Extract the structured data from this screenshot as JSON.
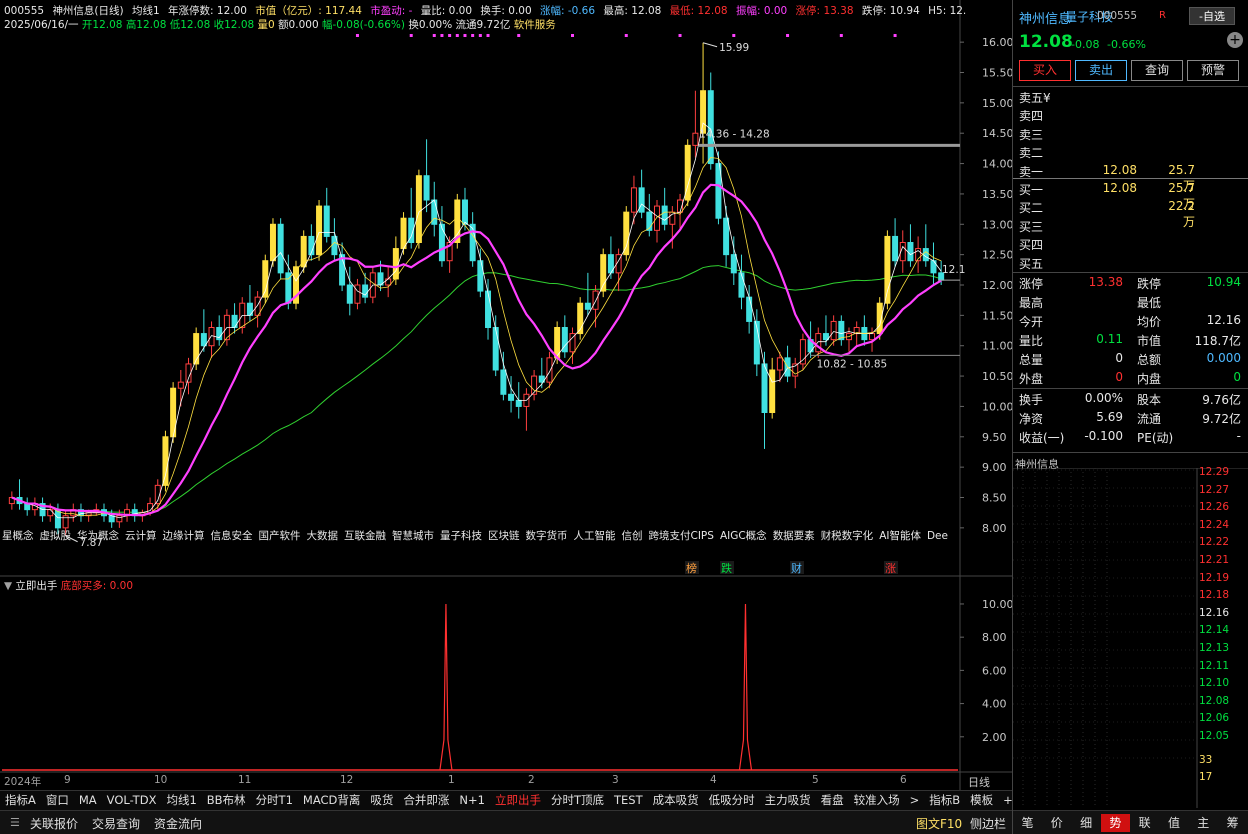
{
  "header": {
    "code": "000555",
    "name": "神州信息(日线)",
    "ma_label": "均线1",
    "ma_desc": "年涨停数: 12.00",
    "mktcap_label": "市值（亿元）: 117.44",
    "pe_label": "市盈动: -",
    "volratio": "量比: 0.00",
    "turnover": "换手: 0.00",
    "amp_label": "涨幅: -0.66",
    "high": "最高: 12.08",
    "low": "最低: 12.08",
    "swing": "振幅: 0.00",
    "limitup": "涨停: 13.38",
    "limitdown": "跌停: 10.94",
    "h5": "H5: 12.",
    "line2_date": "2025/06/16/一",
    "line2_open": "开12.08",
    "line2_high": "高12.08",
    "line2_low": "低12.08",
    "line2_close": "收12.08",
    "line2_vol": "量0",
    "line2_amt": "额0.000",
    "line2_chg": "幅-0.08(-0.66%)",
    "line2_turn": "换0.00%",
    "line2_float": "流通9.72亿",
    "line2_sector": "软件服务"
  },
  "concepts": [
    "星概念",
    "虚拟股",
    "华为概念",
    "云计算",
    "边缘计算",
    "信息安全",
    "国产软件",
    "大数据",
    "互联金融",
    "智慧城市",
    "量子科技",
    "区块链",
    "数字货币",
    "人工智能",
    "信创",
    "跨境支付CIPS",
    "AIGC概念",
    "数据要素",
    "财税数字化",
    "AI智能体",
    "Dee"
  ],
  "annotations": {
    "high_label": "15.99",
    "low_label": "7.87",
    "range1": "14.36 - 14.28",
    "range2": "10.82 - 10.85",
    "last_tag": "12.1"
  },
  "event_tags": [
    {
      "text": "榜",
      "color": "#ffa040"
    },
    {
      "text": "跌",
      "color": "#00e040"
    },
    {
      "text": "财",
      "color": "#4fb9ff"
    },
    {
      "text": "涨",
      "color": "#ff3030"
    }
  ],
  "yaxis": [
    "16.00",
    "15.50",
    "15.00",
    "14.50",
    "14.00",
    "13.50",
    "13.00",
    "12.50",
    "12.00",
    "11.50",
    "11.00",
    "10.50",
    "10.00",
    "9.50",
    "9.00",
    "8.50",
    "8.00"
  ],
  "indicator": {
    "name": "立即出手",
    "value_label": "底部买多: 0.00",
    "yaxis": [
      "10.00",
      "8.00",
      "6.00",
      "4.00",
      "2.00"
    ]
  },
  "xaxis": [
    "2024年",
    "9",
    "10",
    "11",
    "12",
    "1",
    "2",
    "3",
    "4",
    "5",
    "6"
  ],
  "period_button": "日线",
  "tabs": [
    "指标A",
    "窗口",
    "MA",
    "VOL-TDX",
    "均线1",
    "BB布林",
    "分时T1",
    "MACD背离",
    "吸货",
    "合并即涨",
    "N+1",
    "立即出手",
    "分时T顶底",
    "TEST",
    "成本吸货",
    "低吸分时",
    "主力吸货",
    "看盘",
    "较准入场",
    ">",
    "指标B",
    "模板",
    "+",
    "-"
  ],
  "active_tab": "立即出手",
  "status": {
    "link_quote": "关联报价",
    "trade_query": "交易查询",
    "capital_flow": "资金流向",
    "f10": "图文F10",
    "sidebar": "侧边栏"
  },
  "right": {
    "name": "神州信息",
    "concept": "量子科技",
    "code": "000555",
    "r_badge": "R",
    "zixuan": "-自选",
    "price": "12.08",
    "chg": "-0.08",
    "pct": "-0.66%",
    "buttons": {
      "buy": "买入",
      "sell": "卖出",
      "query": "查询",
      "alert": "预警"
    },
    "asks": [
      {
        "label": "卖五¥",
        "price": "",
        "vol": ""
      },
      {
        "label": "卖四",
        "price": "",
        "vol": ""
      },
      {
        "label": "卖三",
        "price": "",
        "vol": ""
      },
      {
        "label": "卖二",
        "price": "",
        "vol": ""
      },
      {
        "label": "卖一",
        "price": "12.08",
        "vol": "25.7万"
      }
    ],
    "bids": [
      {
        "label": "买一",
        "price": "12.08",
        "vol": "25.7万"
      },
      {
        "label": "买二",
        "price": "",
        "vol": "22.2万"
      },
      {
        "label": "买三",
        "price": "",
        "vol": ""
      },
      {
        "label": "买四",
        "price": "",
        "vol": ""
      },
      {
        "label": "买五",
        "price": "",
        "vol": ""
      }
    ],
    "stats1": [
      {
        "l1": "涨停",
        "v1": "13.38",
        "c1": "red",
        "l2": "跌停",
        "v2": "10.94",
        "c2": "green"
      },
      {
        "l1": "最高",
        "v1": "",
        "c1": "white",
        "l2": "最低",
        "v2": "",
        "c2": "white"
      },
      {
        "l1": "今开",
        "v1": "",
        "c1": "white",
        "l2": "均价",
        "v2": "12.16",
        "c2": "white"
      },
      {
        "l1": "量比",
        "v1": "0.11",
        "c1": "green",
        "l2": "市值",
        "v2": "118.7亿",
        "c2": "white"
      },
      {
        "l1": "总量",
        "v1": "0",
        "c1": "white",
        "l2": "总额",
        "v2": "0.000",
        "c2": "blue"
      },
      {
        "l1": "外盘",
        "v1": "0",
        "c1": "red",
        "l2": "内盘",
        "v2": "0",
        "c2": "green"
      }
    ],
    "stats2": [
      {
        "l1": "换手",
        "v1": "0.00%",
        "c1": "white",
        "l2": "股本",
        "v2": "9.76亿",
        "c2": "white"
      },
      {
        "l1": "净资",
        "v1": "5.69",
        "c1": "white",
        "l2": "流通",
        "v2": "9.72亿",
        "c2": "white"
      },
      {
        "l1": "收益(一)",
        "v1": "-0.100",
        "c1": "white",
        "l2": "PE(动)",
        "v2": "-",
        "c2": "white"
      }
    ],
    "mini_title": "神州信息",
    "mini_labels": [
      {
        "v": "12.29",
        "c": "red"
      },
      {
        "v": "12.27",
        "c": "red"
      },
      {
        "v": "12.26",
        "c": "red"
      },
      {
        "v": "12.24",
        "c": "red"
      },
      {
        "v": "12.22",
        "c": "red"
      },
      {
        "v": "12.21",
        "c": "red"
      },
      {
        "v": "12.19",
        "c": "red"
      },
      {
        "v": "12.18",
        "c": "red"
      },
      {
        "v": "12.16",
        "c": "white"
      },
      {
        "v": "12.14",
        "c": "green"
      },
      {
        "v": "12.13",
        "c": "green"
      },
      {
        "v": "12.11",
        "c": "green"
      },
      {
        "v": "12.10",
        "c": "green"
      },
      {
        "v": "12.08",
        "c": "green"
      },
      {
        "v": "12.06",
        "c": "green"
      },
      {
        "v": "12.05",
        "c": "green"
      },
      {
        "v": "33",
        "c": "yellow"
      },
      {
        "v": "17",
        "c": "yellow"
      }
    ],
    "bottom_tabs": [
      "笔",
      "价",
      "细",
      "势",
      "联",
      "值",
      "主",
      "筹"
    ],
    "bottom_active": "势"
  },
  "chart_data": {
    "type": "candlestick",
    "ylim": [
      7.8,
      16.2
    ],
    "candles": [
      [
        8.4,
        8.6,
        8.3,
        8.5
      ],
      [
        8.5,
        8.8,
        8.3,
        8.4
      ],
      [
        8.4,
        8.5,
        8.2,
        8.3
      ],
      [
        8.3,
        8.5,
        8.2,
        8.4
      ],
      [
        8.4,
        8.5,
        8.1,
        8.2
      ],
      [
        8.2,
        8.4,
        8.1,
        8.3
      ],
      [
        8.3,
        8.4,
        7.9,
        8.0
      ],
      [
        8.0,
        8.3,
        7.87,
        8.2
      ],
      [
        8.2,
        8.4,
        8.1,
        8.3
      ],
      [
        8.3,
        8.4,
        8.1,
        8.2
      ],
      [
        8.2,
        8.3,
        8.1,
        8.25
      ],
      [
        8.25,
        8.4,
        8.2,
        8.3
      ],
      [
        8.3,
        8.4,
        8.1,
        8.2
      ],
      [
        8.2,
        8.3,
        8.0,
        8.1
      ],
      [
        8.1,
        8.3,
        8.0,
        8.2
      ],
      [
        8.2,
        8.4,
        8.1,
        8.3
      ],
      [
        8.3,
        8.4,
        8.1,
        8.2
      ],
      [
        8.2,
        8.3,
        8.1,
        8.25
      ],
      [
        8.25,
        8.5,
        8.2,
        8.4
      ],
      [
        8.4,
        8.8,
        8.3,
        8.7
      ],
      [
        8.7,
        9.6,
        8.6,
        9.5
      ],
      [
        9.5,
        10.4,
        9.4,
        10.3
      ],
      [
        10.3,
        10.6,
        10.0,
        10.4
      ],
      [
        10.4,
        10.8,
        10.2,
        10.7
      ],
      [
        10.7,
        11.3,
        10.6,
        11.2
      ],
      [
        11.2,
        11.6,
        10.9,
        11.0
      ],
      [
        11.0,
        11.4,
        10.8,
        11.3
      ],
      [
        11.3,
        11.5,
        11.0,
        11.1
      ],
      [
        11.1,
        11.6,
        11.0,
        11.5
      ],
      [
        11.5,
        11.7,
        11.2,
        11.3
      ],
      [
        11.3,
        11.8,
        11.2,
        11.7
      ],
      [
        11.7,
        12.0,
        11.4,
        11.5
      ],
      [
        11.5,
        11.9,
        11.3,
        11.8
      ],
      [
        11.8,
        12.5,
        11.7,
        12.4
      ],
      [
        12.4,
        13.1,
        12.3,
        13.0
      ],
      [
        13.0,
        13.1,
        12.1,
        12.2
      ],
      [
        12.2,
        12.5,
        11.6,
        11.7
      ],
      [
        11.7,
        12.4,
        11.6,
        12.3
      ],
      [
        12.3,
        12.9,
        12.2,
        12.8
      ],
      [
        12.8,
        13.0,
        12.4,
        12.5
      ],
      [
        12.5,
        13.4,
        12.4,
        13.3
      ],
      [
        13.3,
        13.6,
        12.7,
        12.8
      ],
      [
        12.8,
        13.1,
        12.4,
        12.5
      ],
      [
        12.5,
        12.7,
        11.9,
        12.0
      ],
      [
        12.0,
        12.3,
        11.5,
        11.7
      ],
      [
        11.7,
        12.1,
        11.6,
        12.0
      ],
      [
        12.0,
        12.2,
        11.7,
        11.8
      ],
      [
        11.8,
        12.3,
        11.7,
        12.2
      ],
      [
        12.2,
        12.4,
        11.9,
        12.0
      ],
      [
        12.0,
        12.3,
        11.8,
        12.1
      ],
      [
        12.1,
        12.8,
        12.0,
        12.6
      ],
      [
        12.6,
        13.2,
        12.5,
        13.1
      ],
      [
        13.1,
        13.6,
        12.6,
        12.7
      ],
      [
        12.7,
        13.9,
        12.6,
        13.8
      ],
      [
        13.8,
        14.4,
        13.2,
        13.4
      ],
      [
        13.4,
        13.7,
        12.8,
        13.0
      ],
      [
        13.0,
        13.3,
        12.3,
        12.4
      ],
      [
        12.4,
        12.8,
        12.2,
        12.7
      ],
      [
        12.7,
        13.5,
        12.6,
        13.4
      ],
      [
        13.4,
        13.6,
        12.9,
        13.0
      ],
      [
        13.0,
        13.2,
        12.3,
        12.4
      ],
      [
        12.4,
        12.6,
        11.8,
        11.9
      ],
      [
        11.9,
        12.1,
        11.1,
        11.3
      ],
      [
        11.3,
        11.5,
        10.5,
        10.6
      ],
      [
        10.6,
        10.9,
        10.1,
        10.2
      ],
      [
        10.2,
        10.5,
        9.9,
        10.1
      ],
      [
        10.1,
        10.4,
        9.8,
        10.0
      ],
      [
        10.0,
        10.3,
        9.6,
        10.2
      ],
      [
        10.2,
        10.6,
        10.1,
        10.5
      ],
      [
        10.5,
        10.8,
        10.3,
        10.4
      ],
      [
        10.4,
        10.9,
        10.3,
        10.8
      ],
      [
        10.8,
        11.4,
        10.7,
        11.3
      ],
      [
        11.3,
        11.5,
        10.8,
        10.9
      ],
      [
        10.9,
        11.3,
        10.7,
        11.2
      ],
      [
        11.2,
        11.8,
        11.1,
        11.7
      ],
      [
        11.7,
        12.2,
        11.5,
        11.6
      ],
      [
        11.6,
        12.0,
        11.3,
        11.9
      ],
      [
        11.9,
        12.6,
        11.8,
        12.5
      ],
      [
        12.5,
        12.8,
        12.1,
        12.2
      ],
      [
        12.2,
        12.6,
        11.9,
        12.5
      ],
      [
        12.5,
        13.3,
        12.4,
        13.2
      ],
      [
        13.2,
        13.8,
        13.0,
        13.6
      ],
      [
        13.6,
        13.9,
        13.1,
        13.2
      ],
      [
        13.2,
        13.5,
        12.8,
        12.9
      ],
      [
        12.9,
        13.4,
        12.7,
        13.3
      ],
      [
        13.3,
        13.6,
        12.9,
        13.0
      ],
      [
        13.0,
        13.3,
        12.6,
        13.2
      ],
      [
        13.2,
        13.5,
        12.9,
        13.4
      ],
      [
        13.4,
        14.4,
        13.3,
        14.3
      ],
      [
        14.3,
        15.2,
        14.1,
        14.5
      ],
      [
        14.5,
        15.99,
        14.0,
        15.2
      ],
      [
        15.2,
        15.5,
        13.9,
        14.0
      ],
      [
        14.0,
        14.2,
        13.0,
        13.1
      ],
      [
        13.1,
        13.3,
        12.3,
        12.5
      ],
      [
        12.5,
        12.8,
        12.0,
        12.2
      ],
      [
        12.2,
        12.5,
        11.6,
        11.8
      ],
      [
        11.8,
        12.0,
        11.2,
        11.4
      ],
      [
        11.4,
        11.6,
        10.5,
        10.7
      ],
      [
        10.7,
        10.9,
        9.3,
        9.9
      ],
      [
        9.9,
        10.8,
        9.8,
        10.6
      ],
      [
        10.6,
        10.9,
        10.4,
        10.8
      ],
      [
        10.8,
        11.0,
        10.4,
        10.5
      ],
      [
        10.5,
        10.8,
        10.3,
        10.7
      ],
      [
        10.7,
        11.2,
        10.6,
        11.1
      ],
      [
        11.1,
        11.4,
        10.8,
        10.9
      ],
      [
        10.9,
        11.3,
        10.8,
        11.2
      ],
      [
        11.2,
        11.5,
        11.0,
        11.1
      ],
      [
        11.1,
        11.5,
        11.0,
        11.4
      ],
      [
        11.4,
        11.5,
        11.0,
        11.1
      ],
      [
        11.1,
        11.3,
        10.9,
        11.2
      ],
      [
        11.2,
        11.4,
        11.0,
        11.3
      ],
      [
        11.3,
        11.5,
        11.0,
        11.1
      ],
      [
        11.1,
        11.3,
        10.9,
        11.2
      ],
      [
        11.2,
        11.8,
        11.1,
        11.7
      ],
      [
        11.7,
        12.9,
        11.6,
        12.8
      ],
      [
        12.8,
        13.1,
        12.3,
        12.4
      ],
      [
        12.4,
        12.9,
        12.2,
        12.7
      ],
      [
        12.7,
        13.0,
        12.3,
        12.4
      ],
      [
        12.4,
        12.8,
        12.2,
        12.6
      ],
      [
        12.6,
        13.0,
        12.3,
        12.4
      ],
      [
        12.4,
        12.7,
        12.0,
        12.2
      ],
      [
        12.2,
        12.4,
        12.0,
        12.08
      ]
    ],
    "indicator_peaks": [
      {
        "index": 56,
        "value": 10.0
      },
      {
        "index": 95,
        "value": 10.0
      }
    ]
  }
}
